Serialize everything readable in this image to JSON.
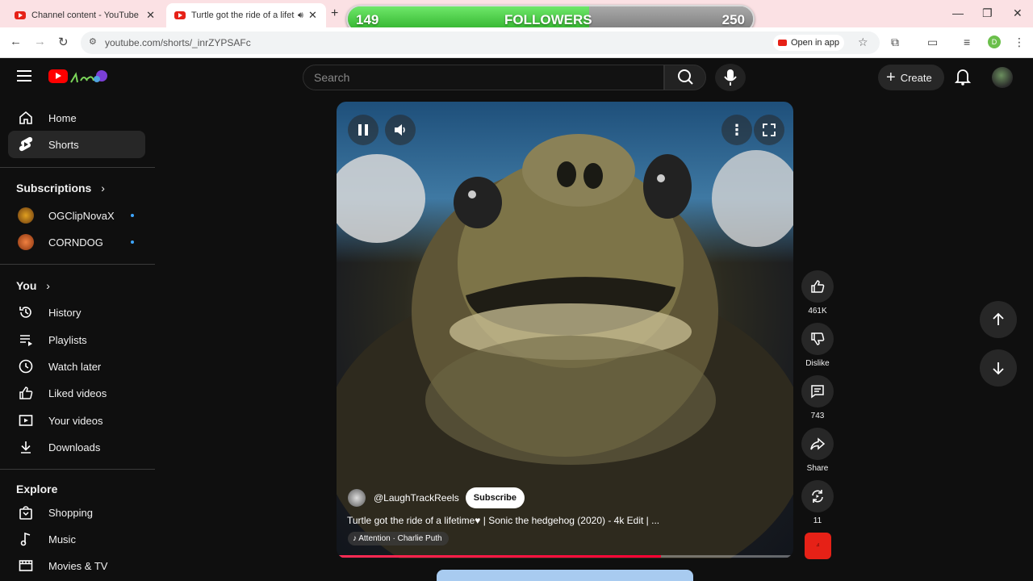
{
  "browser": {
    "tabs": [
      {
        "title": "Channel content - YouTube Studio",
        "active": false
      },
      {
        "title": "Turtle got the ride of a lifetime",
        "active": true
      }
    ],
    "url": "youtube.com/shorts/_inrZYPSAFc",
    "open_in_app": "Open in app",
    "profile_initial": "D"
  },
  "followers_widget": {
    "current": "149",
    "label": "FOLLOWERS",
    "goal": "250",
    "progress_fraction": 0.596
  },
  "header": {
    "search_placeholder": "Search",
    "create_label": "Create"
  },
  "sidebar": {
    "main": [
      {
        "label": "Home",
        "icon": "home-icon"
      },
      {
        "label": "Shorts",
        "icon": "shorts-icon",
        "active": true
      }
    ],
    "subscriptions_heading": "Subscriptions",
    "subscriptions": [
      {
        "label": "OGClipNovaX",
        "color": "#b5651d"
      },
      {
        "label": "CORNDOG",
        "color": "#d2691e"
      }
    ],
    "you_heading": "You",
    "you": [
      {
        "label": "History",
        "icon": "history-icon"
      },
      {
        "label": "Playlists",
        "icon": "playlists-icon"
      },
      {
        "label": "Watch later",
        "icon": "watch-later-icon"
      },
      {
        "label": "Liked videos",
        "icon": "liked-icon"
      },
      {
        "label": "Your videos",
        "icon": "your-videos-icon"
      },
      {
        "label": "Downloads",
        "icon": "download-icon"
      }
    ],
    "explore_heading": "Explore",
    "explore": [
      {
        "label": "Shopping",
        "icon": "shopping-icon"
      },
      {
        "label": "Music",
        "icon": "music-icon"
      },
      {
        "label": "Movies & TV",
        "icon": "movies-icon"
      }
    ]
  },
  "short": {
    "channel": "@LaughTrackReels",
    "subscribe_label": "Subscribe",
    "title": "Turtle got the ride of a lifetime♥ | Sonic the hedgehog (2020) - 4k Edit | ...",
    "music": "Attention · Charlie Puth",
    "progress_fraction": 0.71
  },
  "actions": {
    "likes": "461K",
    "dislike_label": "Dislike",
    "comments": "743",
    "share_label": "Share",
    "remix_count": "11"
  },
  "colors": {
    "accent_red": "#ff0000",
    "followers_green": "#3cc43a",
    "link_blue": "#3ea6ff"
  }
}
